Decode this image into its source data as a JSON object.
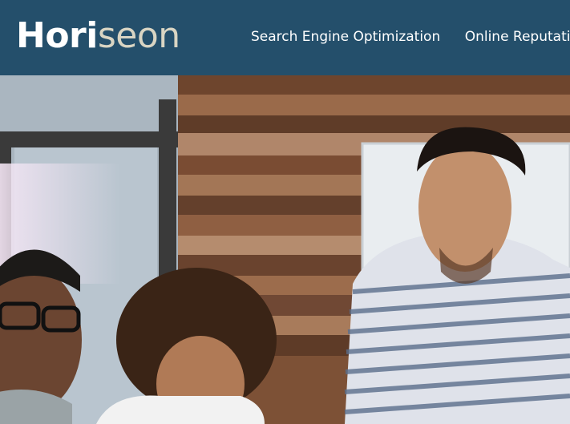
{
  "header": {
    "logo_part1": "Hori",
    "logo_part2": "seon",
    "nav": [
      {
        "label": "Search Engine Optimization"
      },
      {
        "label": "Online Reputation Management"
      }
    ]
  },
  "hero": {
    "image_description_icon": "hero-image",
    "colors": {
      "header_bg": "#244f6b",
      "wood": "#8a5a3c",
      "window_frame": "#3a3a3a"
    }
  }
}
